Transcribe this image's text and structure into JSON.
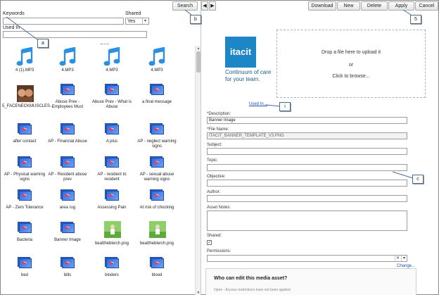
{
  "search": {
    "keywords_label": "Keywords",
    "shared_label": "Shared",
    "shared_value": "Yes",
    "used_in_label": "Used In",
    "search_button": "Search",
    "prev_label": "◀",
    "next_label": "▶"
  },
  "toolbar": {
    "download": "Download",
    "new": "New",
    "delete": "Delete",
    "apply": "Apply",
    "cancel": "Cancel"
  },
  "media": [
    {
      "label": "4 (1).MP3",
      "kind": "audio"
    },
    {
      "label": "4.MP3",
      "kind": "audio"
    },
    {
      "label": "4.MP3",
      "kind": "audio"
    },
    {
      "label": "4.MP3",
      "kind": "audio"
    },
    {
      "label": "5_FACENECKMUSCLES...",
      "kind": "photo"
    },
    {
      "label": "Abuse Prev - Employees Must",
      "kind": "video"
    },
    {
      "label": "Abuse Prev - What is Abuse",
      "kind": "video"
    },
    {
      "label": "a final message",
      "kind": "video"
    },
    {
      "label": "after contact",
      "kind": "video"
    },
    {
      "label": "AP - Financial Abuse",
      "kind": "video"
    },
    {
      "label": "A plus",
      "kind": "video"
    },
    {
      "label": "AP - neglect warning signs",
      "kind": "video"
    },
    {
      "label": "AP - Physical warning signs",
      "kind": "video"
    },
    {
      "label": "AP - Resident abuse prev",
      "kind": "video"
    },
    {
      "label": "AP - resident to resident",
      "kind": "video"
    },
    {
      "label": "AP - sexual abuse warning signs",
      "kind": "video"
    },
    {
      "label": "AP - Zero Tolerance",
      "kind": "video"
    },
    {
      "label": "area rug",
      "kind": "video"
    },
    {
      "label": "Assessing Pain",
      "kind": "video"
    },
    {
      "label": "At risk of chocking",
      "kind": "video"
    },
    {
      "label": "Bacteria",
      "kind": "video"
    },
    {
      "label": "Banner Image",
      "kind": "video"
    },
    {
      "label": "beattheblerch.png",
      "kind": "green"
    },
    {
      "label": "beattheblerch.png",
      "kind": "green"
    },
    {
      "label": "bed",
      "kind": "video"
    },
    {
      "label": "bills",
      "kind": "video"
    },
    {
      "label": "binders",
      "kind": "video"
    },
    {
      "label": "blood",
      "kind": "video"
    }
  ],
  "preview": {
    "logo_text": "itacit",
    "logo_tagline": "Continuum of care for your team.",
    "drop_line1": "Drop a file here to upload it",
    "drop_or": "or",
    "drop_line2": "Click to browse..."
  },
  "details": {
    "used_in_link": "Used In...",
    "description_label": "*Description:",
    "description_value": "Banner Image",
    "filename_label": "*File Name:",
    "filename_value": "ITACIT_BANNER_TEMPLATE_V3.PNG",
    "subject_label": "Subject:",
    "topic_label": "Topic:",
    "objective_label": "Objective:",
    "author_label": "Author:",
    "asset_notes_label": "Asset Notes:",
    "shared_label": "Shared:",
    "shared_checked": "✓",
    "permissions_label": "Permissions:",
    "perm_clear": "✕",
    "perm_drop": "▾",
    "change_link": "Change...",
    "who_heading": "Who can edit this media asset?",
    "who_sub": "Open - Access restrictions have not been applied"
  },
  "callouts": {
    "a": "a",
    "b": "b",
    "c": "c",
    "i": "i",
    "five": "5"
  },
  "colors": {
    "link": "#1a4fb5",
    "audio": "#2d8fe0",
    "video": "#2f6bd8",
    "brand": "#1c86c6"
  }
}
